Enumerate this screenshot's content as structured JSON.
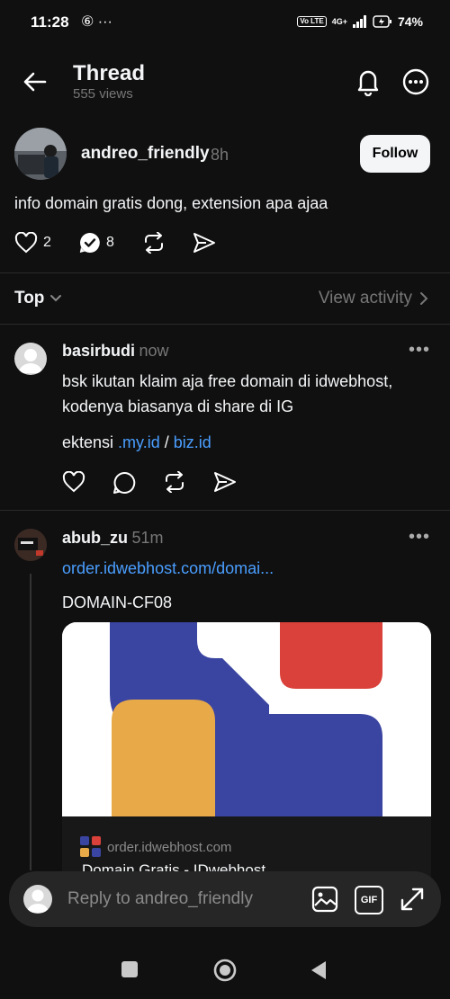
{
  "status": {
    "time": "11:28",
    "left_icons": "⑥ ···",
    "network_badge": "Vo LTE",
    "network_type": "4G+",
    "battery": "74%"
  },
  "header": {
    "title": "Thread",
    "views": "555 views"
  },
  "post": {
    "username": "andreo_friendly",
    "time": "8h",
    "follow_label": "Follow",
    "text": "info domain gratis dong, extension apa ajaa",
    "likes": "2",
    "replies": "8"
  },
  "sort": {
    "label": "Top",
    "view_activity": "View activity"
  },
  "replies": [
    {
      "username": "basirbudi",
      "time": "now",
      "line1": "bsk ikutan klaim aja free domain di idwebhost,",
      "line2": "kodenya biasanya di share di IG",
      "ext_prefix": "ektensi ",
      "ext_link1": ".my.id",
      "ext_sep": " / ",
      "ext_link2": "biz.id"
    },
    {
      "username": "abub_zu",
      "time": "51m",
      "link": "order.idwebhost.com/domai...",
      "code": "DOMAIN-CF08",
      "card_domain": "order.idwebhost.com",
      "card_title": "Domain Gratis - IDwebhost"
    }
  ],
  "composer": {
    "placeholder": "Reply to andreo_friendly",
    "gif_label": "GIF"
  },
  "colors": {
    "background": "#101010",
    "link": "#4a9eff",
    "brand_blue": "#3a44a1",
    "brand_red": "#d9413a",
    "brand_orange": "#e8a948"
  }
}
